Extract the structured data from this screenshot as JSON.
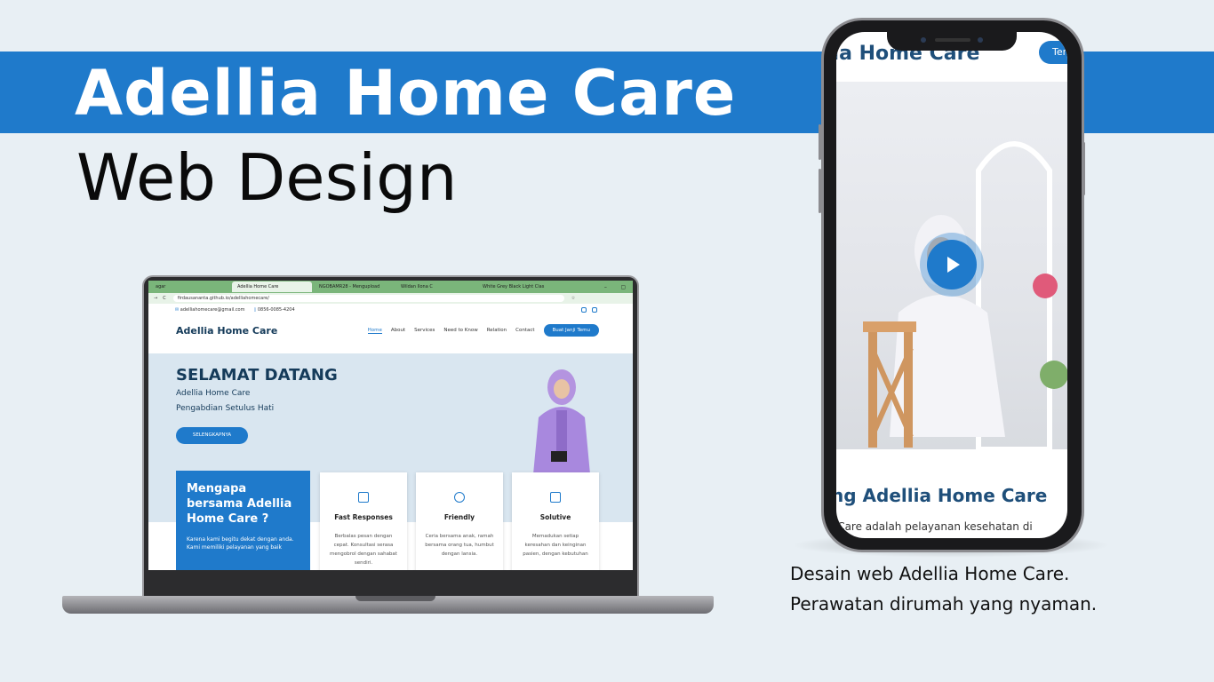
{
  "hero": {
    "title": "Adellia Home Care",
    "subtitle": "Web Design"
  },
  "colors": {
    "brand_blue": "#1f7acb",
    "navy": "#153b5a",
    "background": "#e8eff4"
  },
  "laptop": {
    "browser": {
      "tabs": [
        "agar",
        "Adellia Home Care",
        "NGOBAMR28 - Mengupload",
        "Wildan Ilona C",
        "White Grey Black Light Clas"
      ],
      "url": "firdausananta.github.io/adelliahomecare/"
    },
    "site": {
      "email": "adelliahomecare@gmail.com",
      "phone": "0856-0085-4204",
      "logo": "Adellia Home Care",
      "nav": [
        "Home",
        "About",
        "Services",
        "Need to Know",
        "Relation",
        "Contact"
      ],
      "nav_cta": "Buat Janji Temu",
      "welcome": "SELAMAT DATANG",
      "hero_line1": "Adellia Home Care",
      "hero_line2": "Pengabdian Setulus Hati",
      "hero_button": "SELENGKAPNYA",
      "why_title": "Mengapa bersama Adellia Home Care ?",
      "why_text": "Karena kami begitu dekat dengan anda. Kami memiliki pelayanan yang baik",
      "cards": [
        {
          "icon": "news-icon",
          "title": "Fast Responses",
          "text": "Berbalas pesan dengan cepat. Konsultasi serasa mengobrol dengan sahabat sendiri."
        },
        {
          "icon": "box-icon",
          "title": "Friendly",
          "text": "Ceria bersama anak, ramah bersama orang tua, humbut dengan lansia."
        },
        {
          "icon": "images-icon",
          "title": "Solutive",
          "text": "Memadukan setiap keresahan dan keinginan pasien, dengan kebutuhan"
        }
      ]
    }
  },
  "phone": {
    "logo": "lia Home Care",
    "cta": "Tem",
    "heading": "ng Adellia Home Care",
    "text": "e Care adalah pelayanan kesehatan di"
  },
  "caption": {
    "line1": "Desain web Adellia Home Care.",
    "line2": "Perawatan dirumah yang nyaman."
  }
}
